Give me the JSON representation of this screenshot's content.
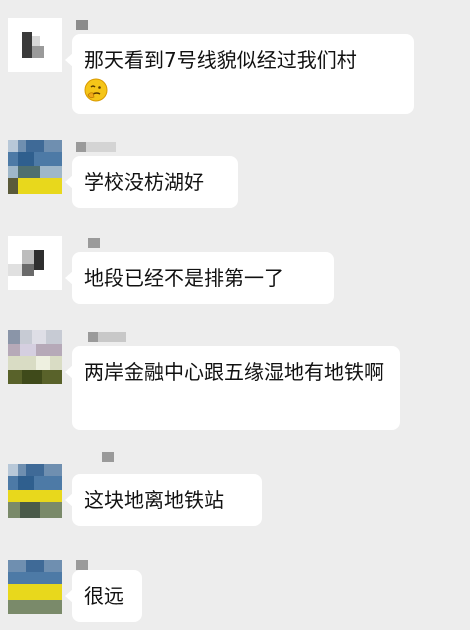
{
  "chat": {
    "messages": [
      {
        "text": "那天看到7号线貌似经过我们村",
        "emoji": "thinking-face-icon"
      },
      {
        "text": "学校没枋湖好"
      },
      {
        "text": "地段已经不是排第一了"
      },
      {
        "text": "两岸金融中心跟五缘湿地有地铁啊"
      },
      {
        "text": "这块地离地铁站"
      },
      {
        "text": "很远"
      }
    ]
  },
  "colors": {
    "background": "#ededed",
    "bubble": "#ffffff",
    "text": "#111111"
  }
}
